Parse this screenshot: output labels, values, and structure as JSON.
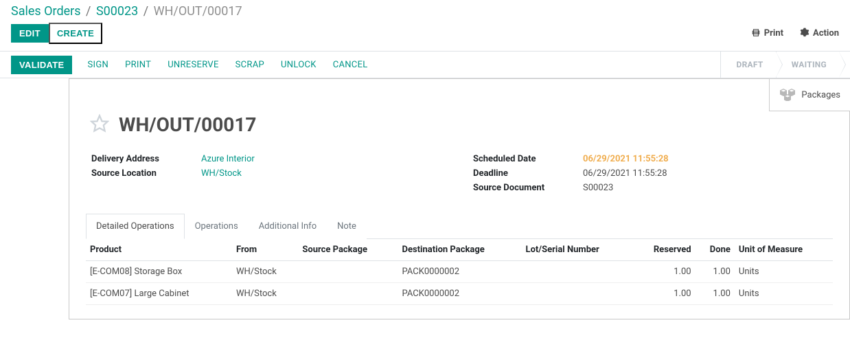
{
  "breadcrumb": {
    "a": "Sales Orders",
    "b": "S00023",
    "c": "WH/OUT/00017"
  },
  "topbar": {
    "edit": "EDIT",
    "create": "CREATE",
    "print": "Print",
    "action": "Action"
  },
  "statusbar": {
    "validate": "VALIDATE",
    "sign": "SIGN",
    "print": "PRINT",
    "unreserve": "UNRESERVE",
    "scrap": "SCRAP",
    "unlock": "UNLOCK",
    "cancel": "CANCEL",
    "stages": {
      "draft": "DRAFT",
      "waiting": "WAITING"
    }
  },
  "button_box": {
    "packages": "Packages"
  },
  "record": {
    "title": "WH/OUT/00017",
    "labels": {
      "delivery_address": "Delivery Address",
      "source_location": "Source Location",
      "scheduled_date": "Scheduled Date",
      "deadline": "Deadline",
      "source_document": "Source Document"
    },
    "delivery_address": "Azure Interior",
    "source_location": "WH/Stock",
    "scheduled_date": "06/29/2021 11:55:28",
    "deadline": "06/29/2021 11:55:28",
    "source_document": "S00023"
  },
  "tabs": {
    "detailed": "Detailed Operations",
    "operations": "Operations",
    "addinfo": "Additional Info",
    "note": "Note"
  },
  "table": {
    "headers": {
      "product": "Product",
      "from": "From",
      "src_pkg": "Source Package",
      "dst_pkg": "Destination Package",
      "lot": "Lot/Serial Number",
      "reserved": "Reserved",
      "done": "Done",
      "uom": "Unit of Measure"
    },
    "rows": [
      {
        "product": "[E-COM08] Storage Box",
        "from": "WH/Stock",
        "src_pkg": "",
        "dst_pkg": "PACK0000002",
        "lot": "",
        "reserved": "1.00",
        "done": "1.00",
        "uom": "Units"
      },
      {
        "product": "[E-COM07] Large Cabinet",
        "from": "WH/Stock",
        "src_pkg": "",
        "dst_pkg": "PACK0000002",
        "lot": "",
        "reserved": "1.00",
        "done": "1.00",
        "uom": "Units"
      }
    ]
  }
}
